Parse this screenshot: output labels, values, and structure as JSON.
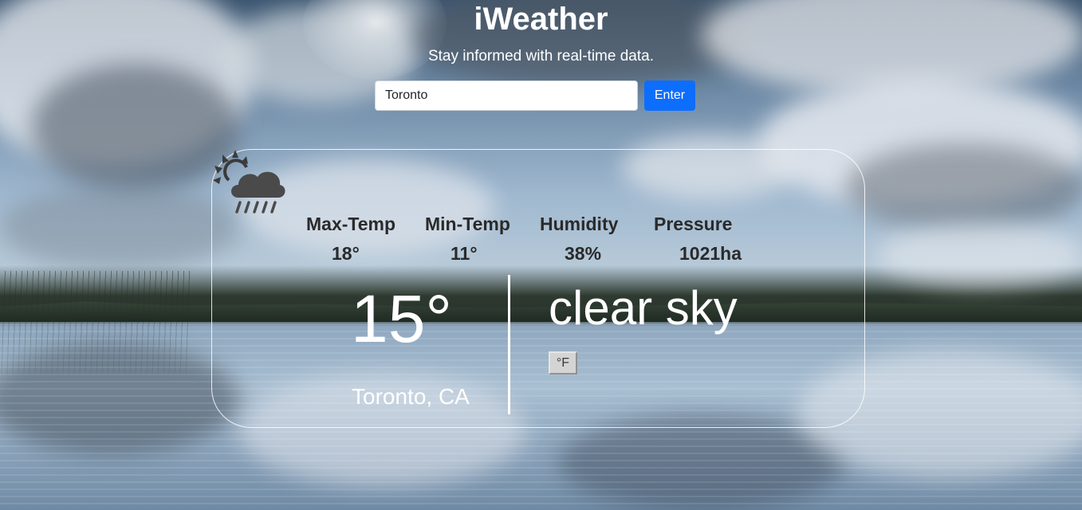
{
  "app": {
    "title": "iWeather",
    "subtitle": "Stay informed with real-time data."
  },
  "search": {
    "value": "Toronto",
    "button_label": "Enter"
  },
  "weather": {
    "icon": "partly-cloudy-rain-icon",
    "stats": [
      {
        "label": "Max-Temp",
        "value": "18°"
      },
      {
        "label": "Min-Temp",
        "value": "11°"
      },
      {
        "label": "Humidity",
        "value": "38%"
      },
      {
        "label": "Pressure",
        "value": "1021ha"
      }
    ],
    "temperature": "15°",
    "location": "Toronto, CA",
    "description": "clear sky",
    "unit_toggle_label": "°F"
  }
}
